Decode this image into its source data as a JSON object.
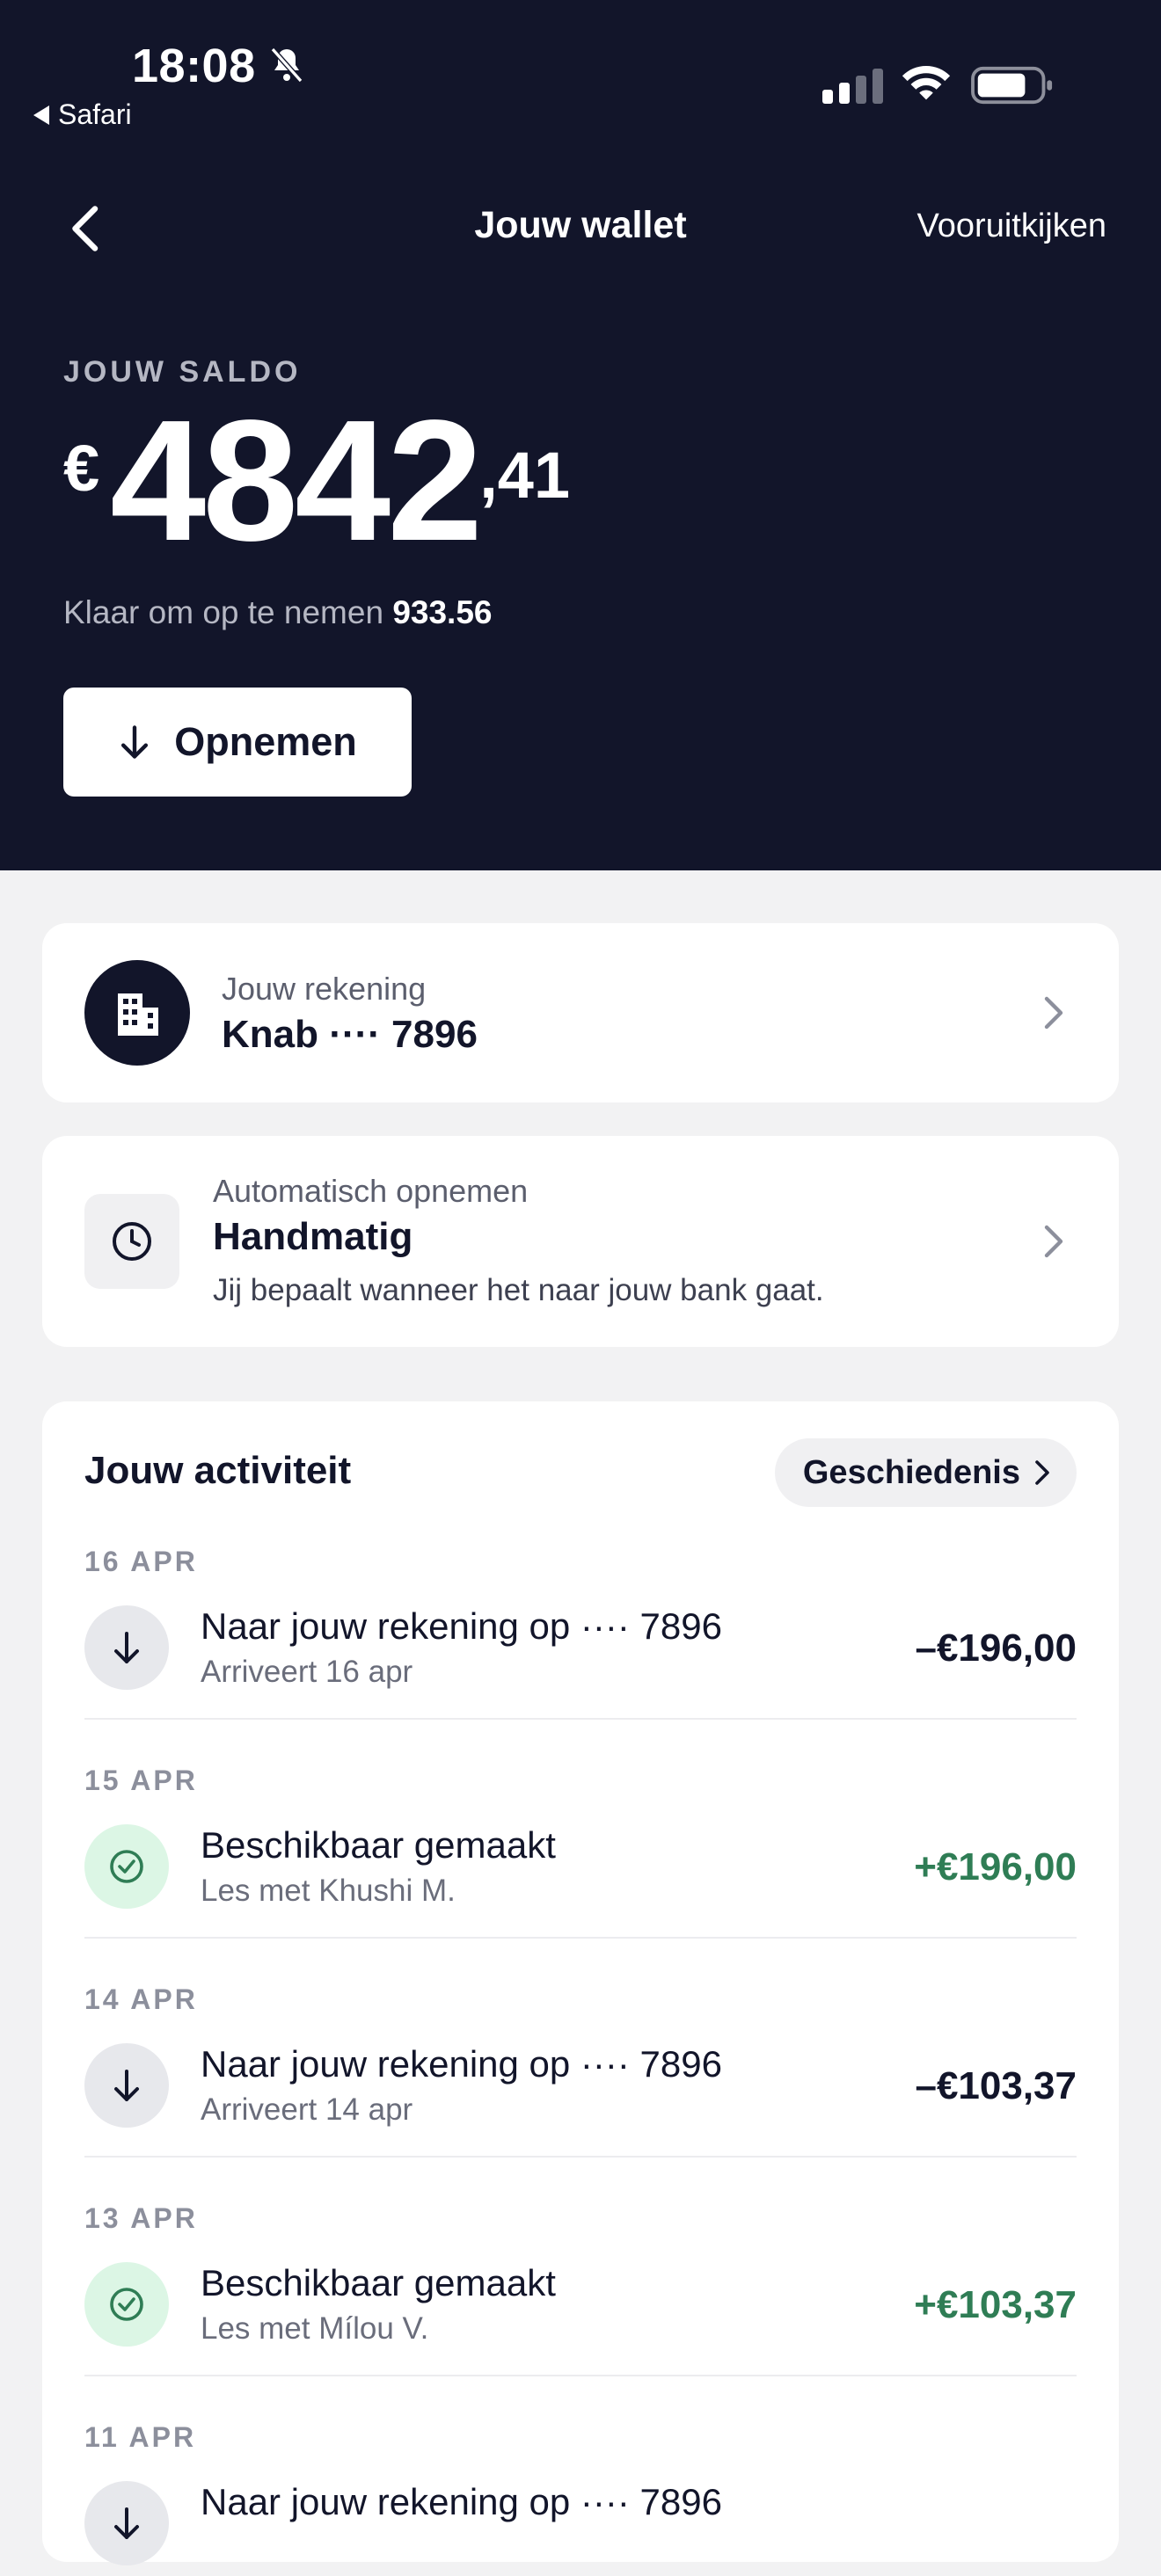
{
  "status_bar": {
    "time": "18:08",
    "back_app": "Safari"
  },
  "nav": {
    "title": "Jouw wallet",
    "right_link": "Vooruitkijken"
  },
  "balance": {
    "label": "JOUW SALDO",
    "currency": "€",
    "integer": "4842",
    "decimal": ",41",
    "available_prefix": "Klaar om op te nemen",
    "available_value": "933.56",
    "withdraw_label": "Opnemen"
  },
  "account": {
    "label": "Jouw rekening",
    "value": "Knab ···· 7896"
  },
  "auto_withdraw": {
    "label": "Automatisch opnemen",
    "value": "Handmatig",
    "description": "Jij bepaalt wanneer het naar jouw bank gaat."
  },
  "activity": {
    "title": "Jouw activiteit",
    "history_label": "Geschiedenis",
    "items": [
      {
        "date": "16 APR",
        "type": "withdrawal",
        "title": "Naar jouw rekening op ···· 7896",
        "subtitle": "Arriveert 16 apr",
        "amount": "–€196,00"
      },
      {
        "date": "15 APR",
        "type": "available",
        "title": "Beschikbaar gemaakt",
        "subtitle": "Les met Khushi M.",
        "amount": "+€196,00"
      },
      {
        "date": "14 APR",
        "type": "withdrawal",
        "title": "Naar jouw rekening op ···· 7896",
        "subtitle": "Arriveert 14 apr",
        "amount": "–€103,37"
      },
      {
        "date": "13 APR",
        "type": "available",
        "title": "Beschikbaar gemaakt",
        "subtitle": "Les met Mílou V.",
        "amount": "+€103,37"
      },
      {
        "date": "11 APR",
        "type": "withdrawal",
        "title": "Naar jouw rekening op ···· 7896",
        "subtitle": "",
        "amount": ""
      }
    ]
  },
  "colors": {
    "hero_bg": "#12152a",
    "positive": "#2f7d55",
    "page_bg": "#f2f2f3"
  }
}
